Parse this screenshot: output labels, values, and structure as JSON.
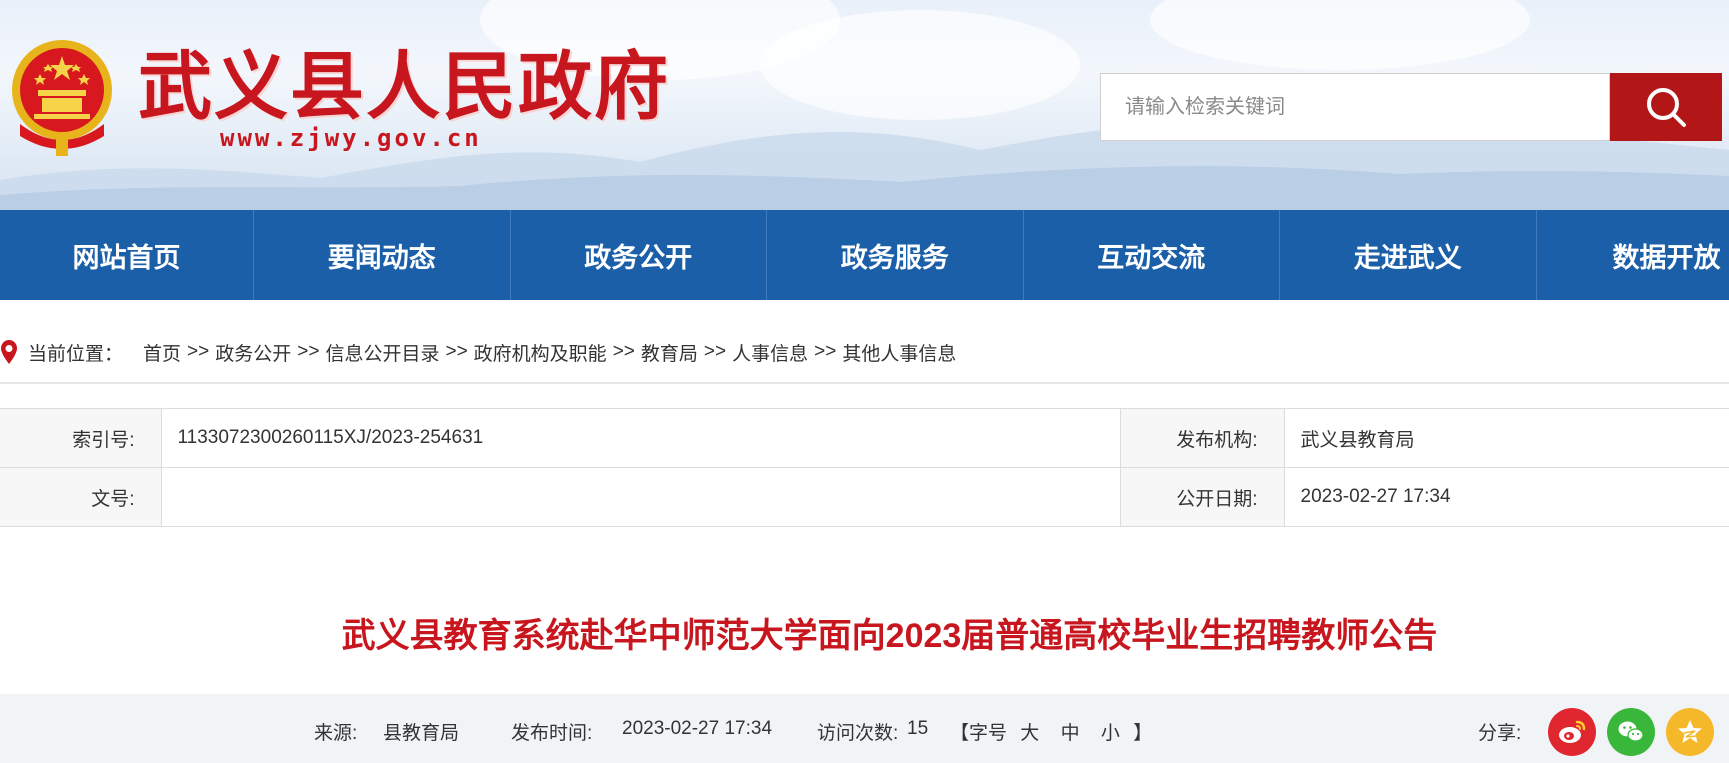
{
  "header": {
    "site_title": "武义县人民政府",
    "site_url": "www.zjwy.gov.cn",
    "search_placeholder": "请输入检索关键词",
    "brand_color": "#c8161e",
    "search_button_icon": "search-icon"
  },
  "nav": {
    "items": [
      {
        "label": "网站首页"
      },
      {
        "label": "要闻动态"
      },
      {
        "label": "政务公开"
      },
      {
        "label": "政务服务"
      },
      {
        "label": "互动交流"
      },
      {
        "label": "走进武义"
      },
      {
        "label": "数据开放"
      }
    ],
    "background": "#1b5fa8"
  },
  "breadcrumb": {
    "icon": "location-pin-icon",
    "label": "当前位置：",
    "items": [
      "首页",
      "政务公开",
      "信息公开目录",
      "政府机构及职能",
      "教育局",
      "人事信息",
      "其他人事信息"
    ],
    "separator": ">>"
  },
  "info": {
    "index_label": "索引号:",
    "index_value": "1133072300260115XJ/2023-254631",
    "publisher_label": "发布机构:",
    "publisher_value": "武义县教育局",
    "doc_no_label": "文号:",
    "doc_no_value": "",
    "date_label": "公开日期:",
    "date_value": "2023-02-27 17:34"
  },
  "article": {
    "title": "武义县教育系统赴华中师范大学面向2023届普通高校毕业生招聘教师公告"
  },
  "meta": {
    "source_label": "来源:",
    "source_value": "县教育局",
    "time_label": "发布时间:",
    "time_value": "2023-02-27 17:34",
    "visits_label": "访问次数:",
    "visits_value": "15",
    "font_open": "【字号",
    "font_large": "大",
    "font_medium": "中",
    "font_small": "小",
    "font_close": "】",
    "share_label": "分享:",
    "share_icons": [
      "weibo-icon",
      "wechat-icon",
      "qzone-icon"
    ]
  }
}
